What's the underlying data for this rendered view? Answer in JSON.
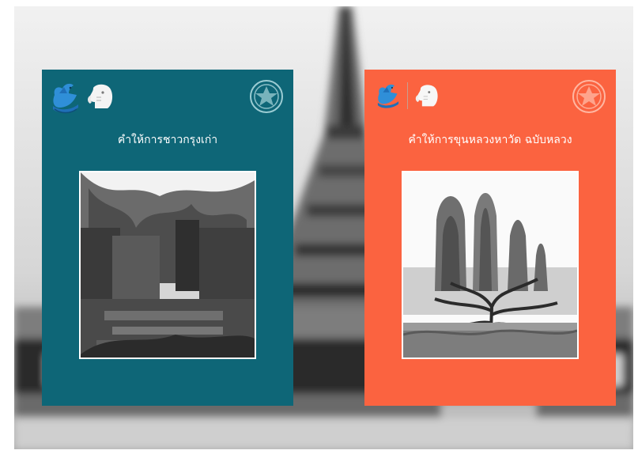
{
  "background": {
    "description_icon": "temple-stupa-background",
    "tone": "grayscale"
  },
  "covers": [
    {
      "title": "คำให้การชาวกรุงเก่า",
      "color": "#0e6677",
      "photo_icon": "ruins-photo"
    },
    {
      "title": "คำให้การขุนหลวงหาวัด ฉบับหลวง",
      "color": "#fb6340",
      "photo_icon": "prang-temple-photo"
    }
  ],
  "icons": {
    "bird": "bird-logo-icon",
    "elephant": "elephant-logo-icon",
    "seal": "seal-emblem-icon"
  }
}
